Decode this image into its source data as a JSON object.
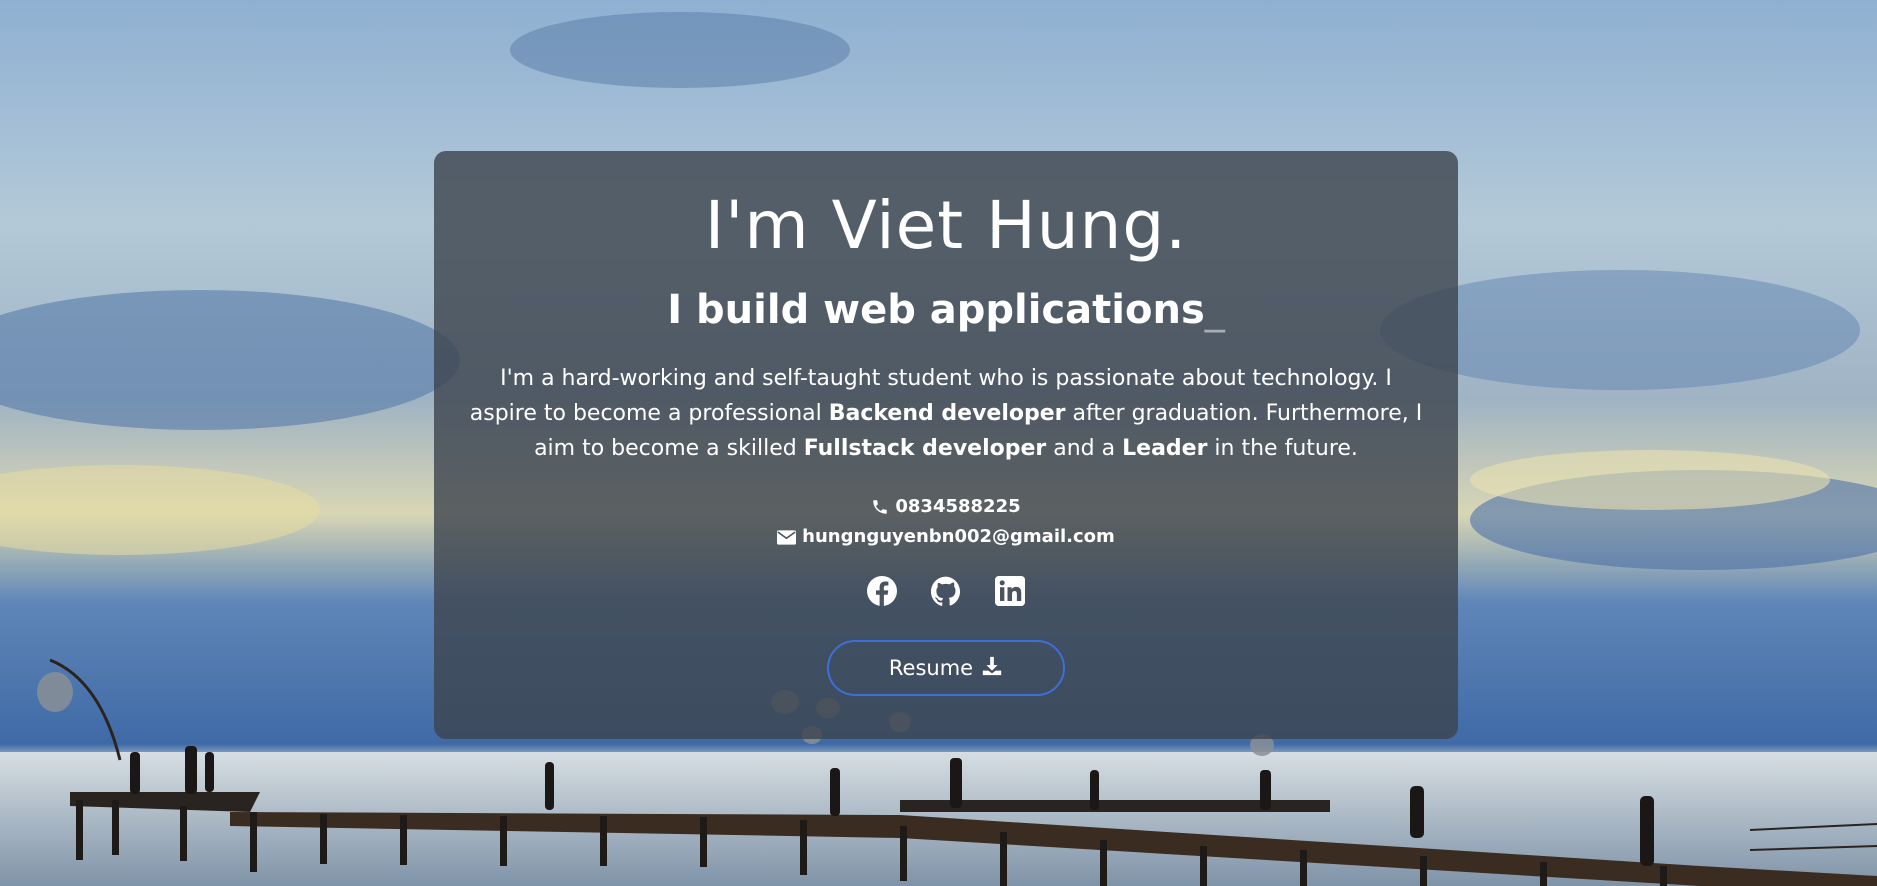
{
  "hero": {
    "name": "I'm Viet Hung.",
    "tagline": "I build web applications",
    "cursor": "_",
    "bio": {
      "intro": "I'm a hard-working and self-taught student who is passionate about technology. I aspire to become a professional ",
      "role1": "Backend developer",
      "mid": " after graduation. Furthermore, I aim to become a skilled ",
      "role2": "Fullstack developer",
      "and": " and a ",
      "role3": "Leader",
      "outro": " in the future."
    },
    "phone": "0834588225",
    "email": "hungnguyenbn002@gmail.com",
    "socials": [
      {
        "icon": "facebook-icon"
      },
      {
        "icon": "github-icon"
      },
      {
        "icon": "linkedin-icon"
      }
    ],
    "resume_label": "Resume"
  },
  "colors": {
    "card_bg": "#3c444e",
    "button_border": "#3d6fd8",
    "text": "#ffffff"
  }
}
